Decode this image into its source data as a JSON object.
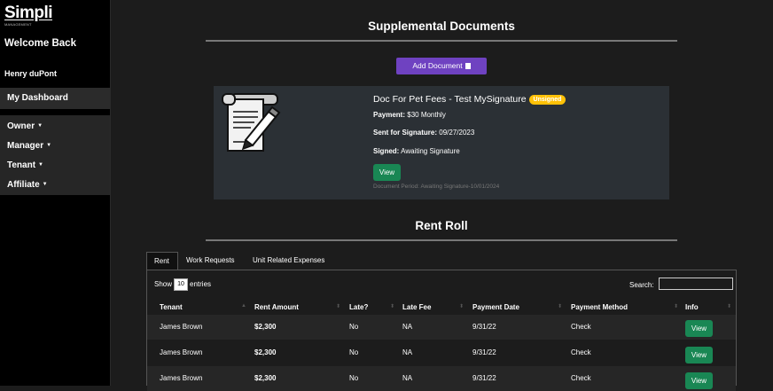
{
  "sidebar": {
    "logo": "Simpli",
    "logo_sub": "MANAGEMENT",
    "welcome": "Welcome Back",
    "user_name": "Henry duPont",
    "dashboard": "My Dashboard",
    "menu": [
      "Owner",
      "Manager",
      "Tenant",
      "Affiliate"
    ]
  },
  "supplemental": {
    "title": "Supplemental Documents",
    "add_button": "Add Document",
    "document": {
      "title": "Doc For Pet Fees - Test MySignature",
      "badge": "Unsigned",
      "payment_label": "Payment:",
      "payment_value": "$30 Monthly",
      "sent_label": "Sent for Signature:",
      "sent_value": "09/27/2023",
      "signed_label": "Signed:",
      "signed_value": "Awaiting Signature",
      "view_button": "View",
      "period": "Document Period: Awaiting Signature-10/01/2024"
    }
  },
  "rent_roll": {
    "title": "Rent Roll",
    "tabs": [
      "Rent",
      "Work Requests",
      "Unit Related Expenses"
    ],
    "active_tab": "Rent",
    "show_label": "Show",
    "entries_value": "10",
    "entries_label": "entries",
    "search_label": "Search:",
    "columns": [
      "Tenant",
      "Rent Amount",
      "Late?",
      "Late Fee",
      "Payment Date",
      "Payment Method",
      "Info"
    ],
    "rows": [
      {
        "tenant": "James Brown",
        "rent": "$2,300",
        "late": "No",
        "fee": "NA",
        "date": "9/31/22",
        "method": "Check",
        "info": "View"
      },
      {
        "tenant": "James Brown",
        "rent": "$2,300",
        "late": "No",
        "fee": "NA",
        "date": "9/31/22",
        "method": "Check",
        "info": "View"
      },
      {
        "tenant": "James Brown",
        "rent": "$2,300",
        "late": "No",
        "fee": "NA",
        "date": "9/31/22",
        "method": "Check",
        "info": "View"
      }
    ]
  },
  "colors": {
    "accent_purple": "#6f42c1",
    "success_green": "#198754",
    "warning_yellow": "#ffc107"
  }
}
